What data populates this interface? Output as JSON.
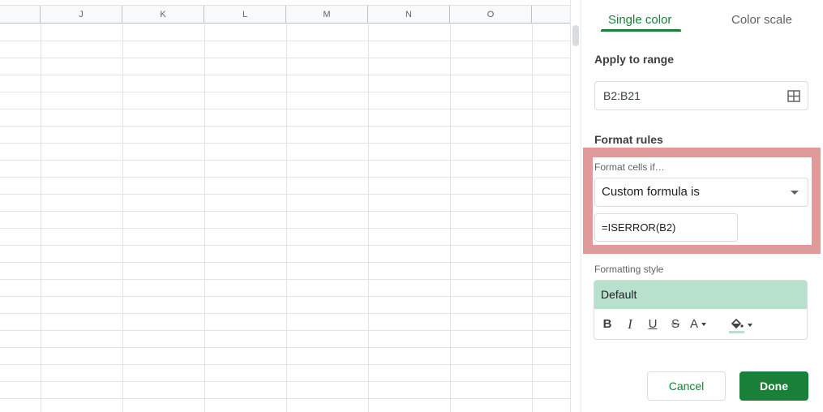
{
  "sheet": {
    "columns": [
      "J",
      "K",
      "L",
      "M",
      "N",
      "O"
    ]
  },
  "panel": {
    "tabs": {
      "single_color": "Single color",
      "color_scale": "Color scale"
    },
    "apply_to_range": {
      "title": "Apply to range",
      "value": "B2:B21",
      "icon": "grid-select-icon"
    },
    "format_rules": {
      "title": "Format rules",
      "cells_if_label": "Format cells if…",
      "condition": "Custom formula is",
      "formula": "=ISERROR(B2)"
    },
    "formatting_style": {
      "label": "Formatting style",
      "preview": "Default",
      "preview_color": "#b7e1cd",
      "toolbar": {
        "bold": "B",
        "italic": "I",
        "underline": "U",
        "strikethrough": "S",
        "text_color": "A"
      }
    },
    "buttons": {
      "cancel": "Cancel",
      "done": "Done"
    }
  },
  "colors": {
    "accent": "#188038",
    "highlight": "#e19a9a"
  }
}
